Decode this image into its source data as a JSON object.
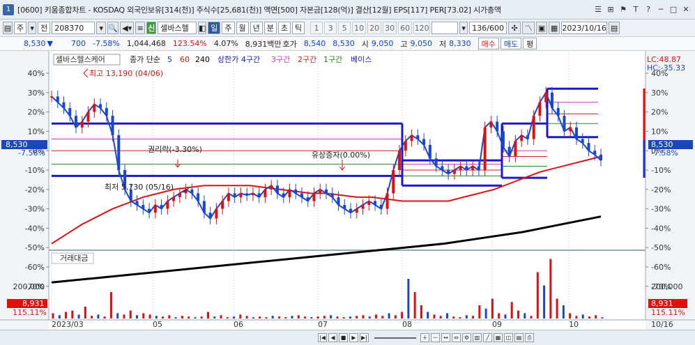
{
  "titlebar": {
    "number": "1",
    "title": "[0600] 키움종합차트 - KOSDAQ 외국인보유[314(천)] 주식수[25,681(천)] 액면[500] 자본금[128(억)] 결산[12월] EPS[117] PER[73.02] 시가총액",
    "buttons": [
      "☰",
      "⊞",
      "⚑",
      "T",
      "?",
      "─",
      "□",
      "✕"
    ]
  },
  "toolbar": {
    "chart_type": "주",
    "market": "전",
    "code": "208370",
    "stock_name": "셀바스헬",
    "period_buttons": [
      "일",
      "주",
      "월",
      "년",
      "분",
      "초",
      "틱"
    ],
    "interval_buttons": [
      "1",
      "3",
      "5",
      "10",
      "20",
      "30",
      "60",
      "120"
    ],
    "count": "136/600",
    "date": "2023/10/16"
  },
  "quote": {
    "price": "8,530",
    "change": "700",
    "change_pct": "-7.58%",
    "volume": "1,044,468",
    "vol_ratio": "123.54%",
    "turnover": "4.07%",
    "amount": "8,931백만",
    "bid_label": "호가",
    "bid": "8,540",
    "ask": "8,530",
    "open_label": "시",
    "open": "9,050",
    "high_label": "고",
    "high": "9,050",
    "low_label": "저",
    "low": "8,330",
    "buy": "매수",
    "sell": "매도",
    "eval": "평"
  },
  "legend": {
    "name": "셀바스헬스케어",
    "ma_label": "종가 단순",
    "ma5": "5",
    "ma60": "60",
    "ma240": "240",
    "upper": "상한가 4구간",
    "z3": "3구간",
    "z2": "2구간",
    "z1": "1구간",
    "base": "베이스",
    "vol_title": "거래대금"
  },
  "annotations": {
    "high": "최고 13,190 (04/06)",
    "low": "최저 5,730 (05/16)",
    "rights": "권리락(-3.30%)",
    "offering": "유상증자(0.00%)",
    "lc": "LC:48.87",
    "hc": "HC:-35.33",
    "left_price": "8,530",
    "left_pct": "-7.58%",
    "right_price": "8,530",
    "right_pct": "-7.58%",
    "vol_left": "8,931",
    "vol_left_pct": "115.11%",
    "vol_right": "8,931",
    "vol_right_pct": "115.11%",
    "end_date": "10/16"
  },
  "chart_data": {
    "type": "line",
    "y_ticks": [
      "40%",
      "30%",
      "20%",
      "10%",
      "0%",
      "-10%",
      "-20%",
      "-30%",
      "-40%",
      "-50%",
      "-60%",
      "-70%"
    ],
    "x_labels": [
      "2023/03",
      "05",
      "06",
      "07",
      "08",
      "09",
      "10"
    ],
    "vol_ticks": [
      "200,000"
    ],
    "close_pct": [
      28,
      25,
      22,
      18,
      12,
      15,
      20,
      24,
      22,
      18,
      8,
      -10,
      -20,
      -26,
      -28,
      -30,
      -32,
      -28,
      -30,
      -26,
      -24,
      -22,
      -20,
      -22,
      -26,
      -32,
      -35,
      -30,
      -26,
      -22,
      -24,
      -22,
      -23,
      -22,
      -24,
      -20,
      -18,
      -22,
      -24,
      -20,
      -22,
      -24,
      -26,
      -22,
      -20,
      -22,
      -24,
      -28,
      -30,
      -32,
      -30,
      -28,
      -26,
      -28,
      -30,
      -22,
      -10,
      0,
      5,
      8,
      6,
      3,
      -4,
      -8,
      -10,
      -12,
      -10,
      -8,
      -10,
      -8,
      -10,
      12,
      15,
      10,
      2,
      -3,
      5,
      8,
      6,
      18,
      25,
      30,
      22,
      18,
      10,
      12,
      6,
      4,
      0,
      -2,
      -5
    ],
    "ma60_pct": [
      -48,
      -43,
      -38,
      -34,
      -30,
      -27,
      -24,
      -22,
      -20,
      -19,
      -18,
      -18,
      -18,
      -18,
      -19,
      -20,
      -21,
      -22,
      -22,
      -23,
      -24,
      -24,
      -25,
      -26,
      -26,
      -26,
      -26,
      -24,
      -22,
      -20,
      -17,
      -14,
      -11,
      -9,
      -7,
      -5,
      -3
    ],
    "ma240_pct": [
      -68,
      -66,
      -64,
      -62,
      -60,
      -58,
      -56,
      -54,
      -52,
      -50,
      -48,
      -45,
      -42,
      -38,
      -34
    ],
    "zones_pct": {
      "upper": 14,
      "z3": 6,
      "z2": 0,
      "z1": -7,
      "base": -13
    },
    "volume": [
      8,
      5,
      10,
      12,
      6,
      18,
      4,
      6,
      3,
      40,
      8,
      6,
      12,
      5,
      8,
      6,
      4,
      3,
      5,
      2,
      4,
      3,
      2,
      3,
      10,
      3,
      5,
      2,
      3,
      6,
      4,
      2,
      3,
      2,
      4,
      3,
      2,
      4,
      5,
      3,
      2,
      3,
      4,
      5,
      3,
      2,
      3,
      4,
      5,
      3,
      6,
      4,
      8,
      5,
      10,
      60,
      40,
      20,
      10,
      6,
      4,
      8,
      3,
      2,
      5,
      4,
      20,
      15,
      30,
      8,
      6,
      25,
      12,
      8,
      4,
      70,
      50,
      90,
      30,
      20,
      8,
      4,
      6,
      3,
      5,
      2
    ]
  }
}
